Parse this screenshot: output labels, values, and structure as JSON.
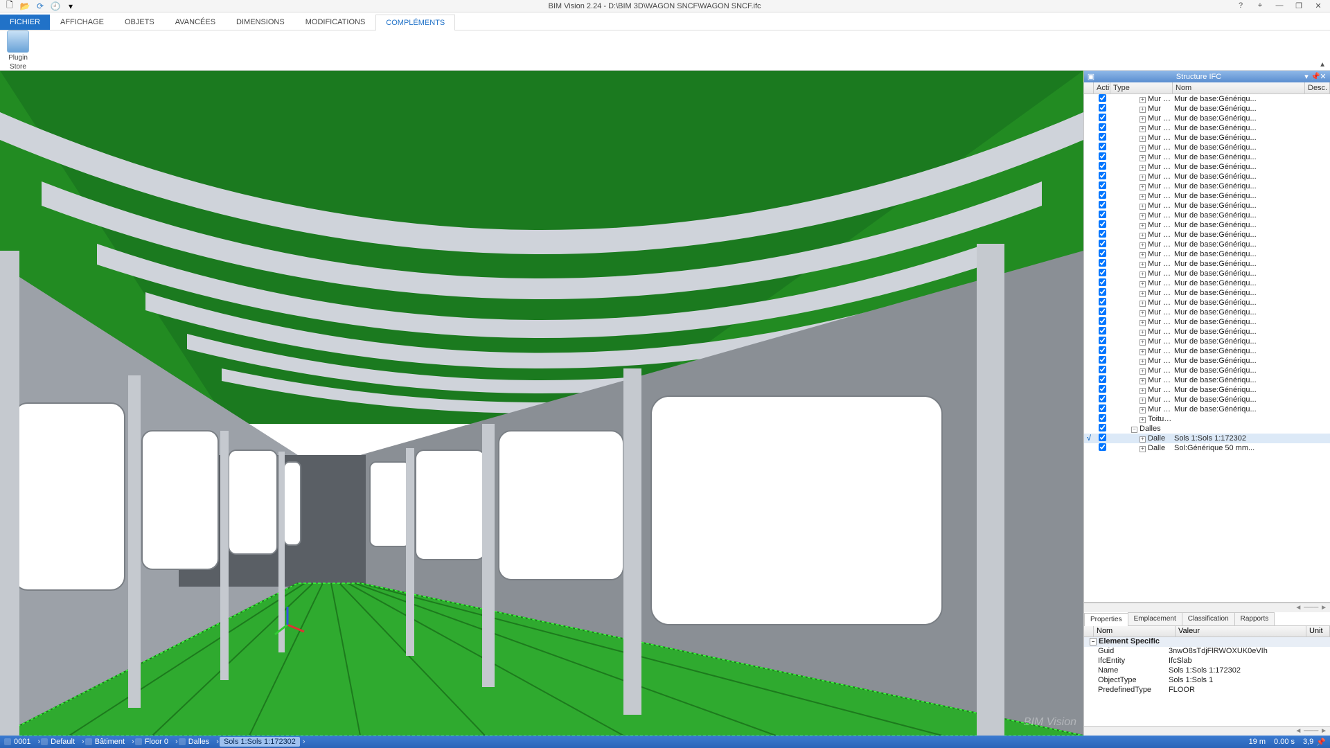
{
  "window": {
    "title": "BIM Vision 2.24 - D:\\BIM 3D\\WAGON SNCF\\WAGON SNCF.ifc",
    "help": "?",
    "winicons": {
      "target": "⌖",
      "min": "—",
      "restore": "❐",
      "close": "✕"
    }
  },
  "quick_access": {
    "newdoc": "🗋",
    "open": "📂",
    "refresh": "⟳",
    "history": "🕘",
    "expand": "▾"
  },
  "tabs": {
    "file": "FICHIER",
    "items": [
      "AFFICHAGE",
      "OBJETS",
      "AVANCÉES",
      "DIMENSIONS",
      "MODIFICATIONS",
      "COMPLÉMENTS"
    ],
    "active": 5
  },
  "ribbon": {
    "plugin_store_l1": "Plugin",
    "plugin_store_l2": "Store",
    "collapse": "▲"
  },
  "structure_panel": {
    "title": "Structure IFC",
    "hdr_icons": {
      "gear": "▣",
      "min": "▾",
      "pin": "📌",
      "close": "✕"
    },
    "cols": {
      "actif": "Actif",
      "type": "Type",
      "nom": "Nom",
      "desc": "Desc."
    },
    "rows": [
      {
        "type": "Mur sta...",
        "nom": "Mur de base:Génériqu..."
      },
      {
        "type": "Mur",
        "nom": "Mur de base:Génériqu..."
      },
      {
        "type": "Mur sta...",
        "nom": "Mur de base:Génériqu..."
      },
      {
        "type": "Mur sta...",
        "nom": "Mur de base:Génériqu..."
      },
      {
        "type": "Mur sta...",
        "nom": "Mur de base:Génériqu..."
      },
      {
        "type": "Mur sta...",
        "nom": "Mur de base:Génériqu..."
      },
      {
        "type": "Mur sta...",
        "nom": "Mur de base:Génériqu..."
      },
      {
        "type": "Mur sta...",
        "nom": "Mur de base:Génériqu..."
      },
      {
        "type": "Mur sta...",
        "nom": "Mur de base:Génériqu..."
      },
      {
        "type": "Mur sta...",
        "nom": "Mur de base:Génériqu..."
      },
      {
        "type": "Mur sta...",
        "nom": "Mur de base:Génériqu..."
      },
      {
        "type": "Mur sta...",
        "nom": "Mur de base:Génériqu..."
      },
      {
        "type": "Mur sta...",
        "nom": "Mur de base:Génériqu..."
      },
      {
        "type": "Mur sta...",
        "nom": "Mur de base:Génériqu..."
      },
      {
        "type": "Mur sta...",
        "nom": "Mur de base:Génériqu..."
      },
      {
        "type": "Mur sta...",
        "nom": "Mur de base:Génériqu..."
      },
      {
        "type": "Mur sta...",
        "nom": "Mur de base:Génériqu..."
      },
      {
        "type": "Mur sta...",
        "nom": "Mur de base:Génériqu..."
      },
      {
        "type": "Mur sta...",
        "nom": "Mur de base:Génériqu..."
      },
      {
        "type": "Mur sta...",
        "nom": "Mur de base:Génériqu..."
      },
      {
        "type": "Mur sta...",
        "nom": "Mur de base:Génériqu..."
      },
      {
        "type": "Mur sta...",
        "nom": "Mur de base:Génériqu..."
      },
      {
        "type": "Mur sta...",
        "nom": "Mur de base:Génériqu..."
      },
      {
        "type": "Mur sta...",
        "nom": "Mur de base:Génériqu..."
      },
      {
        "type": "Mur sta...",
        "nom": "Mur de base:Génériqu..."
      },
      {
        "type": "Mur sta...",
        "nom": "Mur de base:Génériqu..."
      },
      {
        "type": "Mur sta...",
        "nom": "Mur de base:Génériqu..."
      },
      {
        "type": "Mur sta...",
        "nom": "Mur de base:Génériqu..."
      },
      {
        "type": "Mur sta...",
        "nom": "Mur de base:Génériqu..."
      },
      {
        "type": "Mur sta...",
        "nom": "Mur de base:Génériqu..."
      },
      {
        "type": "Mur sta...",
        "nom": "Mur de base:Génériqu..."
      },
      {
        "type": "Mur sta...",
        "nom": "Mur de base:Génériqu..."
      },
      {
        "type": "Mur sta...",
        "nom": "Mur de base:Génériqu..."
      },
      {
        "type": "Toitures/ ...",
        "nom": ""
      },
      {
        "type": "Dalles",
        "nom": "",
        "group": true
      },
      {
        "type": "Dalle",
        "nom": "Sols 1:Sols 1:172302",
        "selected": true
      },
      {
        "type": "Dalle",
        "nom": "Sol:Générique 50 mm..."
      }
    ]
  },
  "props_panel": {
    "tabs": [
      "Properties",
      "Emplacement",
      "Classification",
      "Rapports"
    ],
    "active": 0,
    "cols": {
      "nom": "Nom",
      "val": "Valeur",
      "unit": "Unit"
    },
    "group": "Element Specific",
    "rows": [
      {
        "n": "Guid",
        "v": "3nwO8sTdjFlRWOXUK0eVIh"
      },
      {
        "n": "IfcEntity",
        "v": "IfcSlab"
      },
      {
        "n": "Name",
        "v": "Sols 1:Sols 1:172302"
      },
      {
        "n": "ObjectType",
        "v": "Sols 1:Sols 1"
      },
      {
        "n": "PredefinedType",
        "v": "FLOOR"
      }
    ]
  },
  "status": {
    "id": "0001",
    "items": [
      "Default",
      "Bâtiment",
      "Floor 0",
      "Dalles"
    ],
    "sel": "Sols 1:Sols 1:172302",
    "dist": "19 m",
    "time": "0.00 s",
    "fps": "3,9",
    "pin": "📌"
  },
  "watermark": "BIM Vision"
}
